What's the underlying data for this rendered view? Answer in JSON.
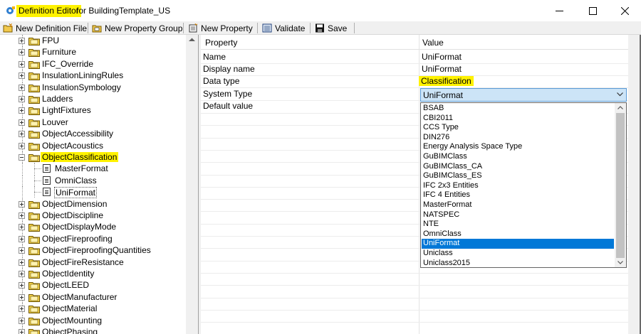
{
  "window": {
    "title_highlighted": "Definition Editor",
    "title_rest": "for BuildingTemplate_US",
    "highlight_color": "#fff200"
  },
  "toolbar": {
    "new_definition_file": "New Definition File",
    "new_property_group": "New Property Group",
    "new_property": "New Property",
    "validate": "Validate",
    "save": "Save"
  },
  "tree": {
    "items": [
      {
        "label": "FPU"
      },
      {
        "label": "Furniture"
      },
      {
        "label": "IFC_Override"
      },
      {
        "label": "InsulationLiningRules"
      },
      {
        "label": "InsulationSymbology"
      },
      {
        "label": "Ladders"
      },
      {
        "label": "LightFixtures"
      },
      {
        "label": "Louver"
      },
      {
        "label": "ObjectAccessibility"
      },
      {
        "label": "ObjectAcoustics"
      },
      {
        "label": "ObjectClassification"
      },
      {
        "label": "ObjectDimension"
      },
      {
        "label": "ObjectDiscipline"
      },
      {
        "label": "ObjectDisplayMode"
      },
      {
        "label": "ObjectFireproofing"
      },
      {
        "label": "ObjectFireproofingQuantities"
      },
      {
        "label": "ObjectFireResistance"
      },
      {
        "label": "ObjectIdentity"
      },
      {
        "label": "ObjectLEED"
      },
      {
        "label": "ObjectManufacturer"
      },
      {
        "label": "ObjectMaterial"
      },
      {
        "label": "ObjectMounting"
      },
      {
        "label": "ObjectPhasing"
      }
    ],
    "expanded": "ObjectClassification",
    "children": [
      {
        "label": "MasterFormat"
      },
      {
        "label": "OmniClass"
      },
      {
        "label": "UniFormat"
      }
    ]
  },
  "grid": {
    "col_property": "Property",
    "col_value": "Value",
    "rows": [
      {
        "property": "Name",
        "value": "UniFormat"
      },
      {
        "property": "Display name",
        "value": "UniFormat"
      },
      {
        "property": "Data type",
        "value": "Classification"
      },
      {
        "property": "System Type",
        "value": "UniFormat"
      },
      {
        "property": "Default value",
        "value": ""
      }
    ]
  },
  "dropdown": {
    "selected": "UniFormat",
    "options": [
      "BSAB",
      "CBI2011",
      "CCS Type",
      "DIN276",
      "Energy Analysis Space Type",
      "GuBIMClass",
      "GuBIMClass_CA",
      "GuBIMClass_ES",
      "IFC 2x3 Entities",
      "IFC 4 Entities",
      "MasterFormat",
      "NATSPEC",
      "NTE",
      "OmniClass",
      "UniFormat",
      "Uniclass",
      "Uniclass2015"
    ],
    "selection_color": "#0078d7"
  }
}
